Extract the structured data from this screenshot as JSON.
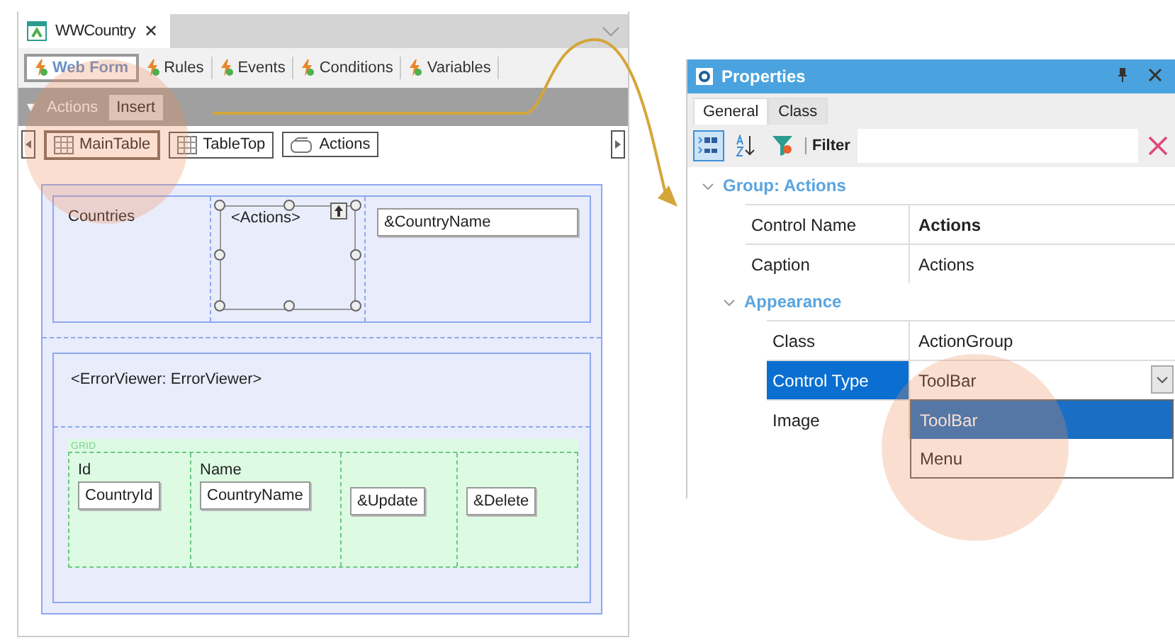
{
  "editor": {
    "tab": {
      "title": "WWCountry",
      "close": "✕"
    },
    "views": [
      {
        "label": "Web Form",
        "selected": true
      },
      {
        "label": "Rules",
        "selected": false
      },
      {
        "label": "Events",
        "selected": false
      },
      {
        "label": "Conditions",
        "selected": false
      },
      {
        "label": "Variables",
        "selected": false
      }
    ],
    "actions_bar": {
      "caret": "▾",
      "label": "Actions",
      "button": "Insert"
    },
    "breadcrumb": [
      {
        "label": "MainTable",
        "kind": "table",
        "selected": true
      },
      {
        "label": "TableTop",
        "kind": "table",
        "selected": false
      },
      {
        "label": "Actions",
        "kind": "group",
        "selected": false
      }
    ],
    "form": {
      "label": "Countries",
      "group": "<Actions>",
      "variable": "&CountryName",
      "error_viewer": "<ErrorViewer: ErrorViewer>",
      "grid": {
        "title": "GRID",
        "columns": [
          {
            "header": "Id",
            "field": "CountryId"
          },
          {
            "header": "Name",
            "field": "CountryName"
          },
          {
            "field": "&Update"
          },
          {
            "field": "&Delete"
          }
        ]
      }
    }
  },
  "properties": {
    "title": "Properties",
    "tabs": [
      {
        "label": "General",
        "selected": true
      },
      {
        "label": "Class",
        "selected": false
      }
    ],
    "filter_label": "Filter",
    "rows": [
      {
        "kind": "group",
        "label": "Group: Actions",
        "expanded": true,
        "children": [
          {
            "kind": "prop",
            "name": "Control Name",
            "value": "Actions",
            "modified": true,
            "selected": false
          },
          {
            "kind": "prop",
            "name": "Caption",
            "value": "Actions",
            "modified": false,
            "selected": false
          },
          {
            "kind": "group",
            "label": "Appearance",
            "expanded": true,
            "children": [
              {
                "kind": "prop",
                "name": "Class",
                "value": "ActionGroup",
                "modified": false,
                "selected": false
              },
              {
                "kind": "prop",
                "name": "Control Type",
                "value": "ToolBar",
                "modified": false,
                "selected": true,
                "dropdown": {
                  "open": true,
                  "options": [
                    {
                      "label": "ToolBar",
                      "selected": true
                    },
                    {
                      "label": "Menu",
                      "selected": false
                    }
                  ]
                }
              },
              {
                "kind": "prop",
                "name": "Image",
                "modified": false,
                "selected": false
              }
            ]
          }
        ]
      }
    ]
  }
}
